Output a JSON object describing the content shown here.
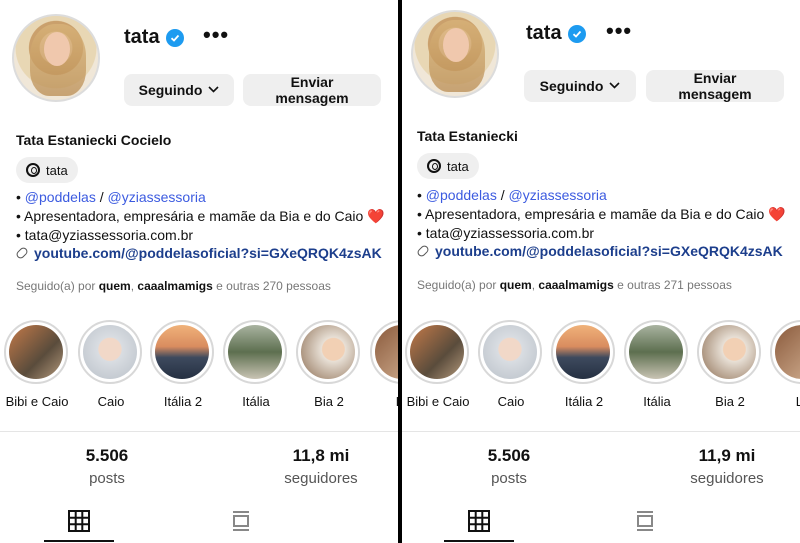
{
  "screens": [
    {
      "username": "tata",
      "following_label": "Seguindo",
      "message_label": "Enviar mensagem",
      "full_name": "Tata Estaniecki Cocielo",
      "threads_label": "tata",
      "mention_1": "@poddelas",
      "mention_sep": " / ",
      "mention_2": "@yziassessoria",
      "bio_line_2": "• Apresentadora, empresária e mamãe da Bia e do Caio ❤️",
      "bio_line_3": "• tata@yziassessoria.com.br",
      "link": "youtube.com/@poddelasoficial?si=GXeQRQK4zsAK",
      "followed_prefix": "Seguido(a) por ",
      "followed_user_1": "quem",
      "followed_user_2": "caaalmamigs",
      "followed_suffix": " e outras 270 pessoas",
      "highlights": [
        "Bibi e Caio",
        "Caio",
        "Itália 2",
        "Itália",
        "Bia 2",
        "Lo"
      ],
      "posts_count": "5.506",
      "posts_label": "posts",
      "followers_count": "11,8 mi",
      "followers_label": "seguidores"
    },
    {
      "username": "tata",
      "following_label": "Seguindo",
      "message_label": "Enviar mensagem",
      "full_name": "Tata Estaniecki",
      "threads_label": "tata",
      "mention_1": "@poddelas",
      "mention_sep": " / ",
      "mention_2": "@yziassessoria",
      "bio_line_2": "• Apresentadora, empresária e mamãe da Bia e do Caio ❤️",
      "bio_line_3": "• tata@yziassessoria.com.br",
      "link": "youtube.com/@poddelasoficial?si=GXeQRQK4zsAK",
      "followed_prefix": "Seguido(a) por ",
      "followed_user_1": "quem",
      "followed_user_2": "caaalmamigs",
      "followed_suffix": " e outras 271 pessoas",
      "highlights": [
        "Bibi e Caio",
        "Caio",
        "Itália 2",
        "Itália",
        "Bia 2",
        "Lo"
      ],
      "posts_count": "5.506",
      "posts_label": "posts",
      "followers_count": "11,9 mi",
      "followers_label": "seguidores"
    }
  ],
  "colors": {
    "verified": "#1d9bf0",
    "mention": "#3c5be0",
    "link": "#1c3e8c"
  },
  "icons": [
    "verified-badge-icon",
    "more-options-icon",
    "chevron-down-icon",
    "threads-icon",
    "link-icon",
    "grid-tab-icon",
    "reels-tab-icon"
  ]
}
